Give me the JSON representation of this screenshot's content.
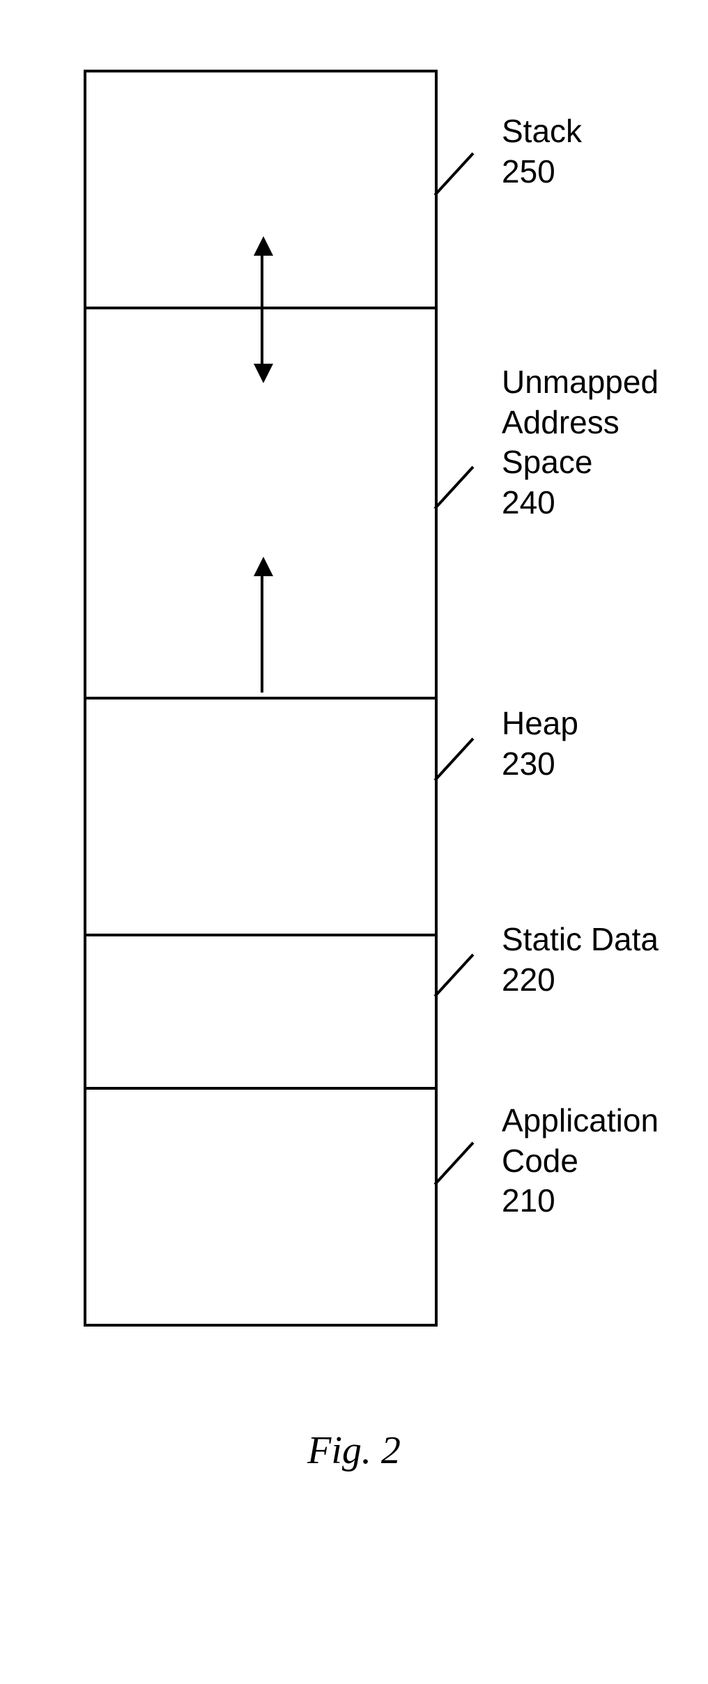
{
  "segments": {
    "stack": {
      "name": "Stack",
      "ref": "250"
    },
    "unmap": {
      "name": "Unmapped",
      "name2": "Address",
      "name3": "Space",
      "ref": "240"
    },
    "heap": {
      "name": "Heap",
      "ref": "230"
    },
    "static": {
      "name": "Static Data",
      "ref": "220"
    },
    "app": {
      "name1": "Application",
      "name2": "Code",
      "ref": "210"
    }
  },
  "figure": "Fig. 2"
}
